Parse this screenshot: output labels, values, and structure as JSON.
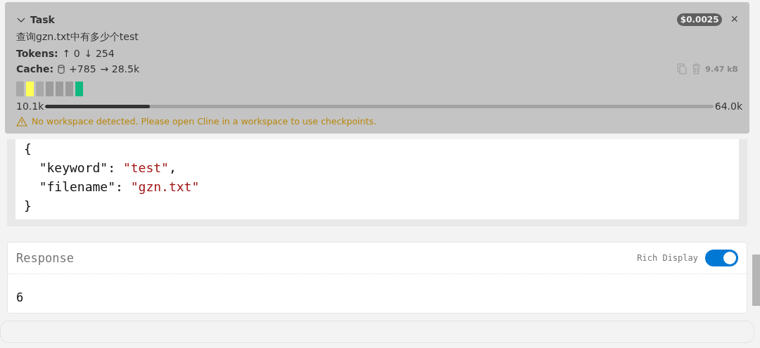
{
  "task": {
    "title": "Task",
    "expanded": true,
    "cost": "$0.0025",
    "close": "×",
    "prompt": "查询gzn.txt中有多少个test",
    "tokens": {
      "label": "Tokens:",
      "up": "↑ 0",
      "down": "↓ 254"
    },
    "cache": {
      "label": "Cache:",
      "added": "+785",
      "arrow": "→ 28.5k"
    },
    "size": "9.47 kB",
    "segments": [
      {
        "color": "#a8a8a8"
      },
      {
        "color": "#ffff55"
      },
      {
        "color": "#a8a8a8"
      },
      {
        "color": "#9c9c9c"
      },
      {
        "color": "#9c9c9c"
      },
      {
        "color": "#9c9c9c"
      },
      {
        "color": "#10b981"
      }
    ],
    "context": {
      "used": "10.1k",
      "level": 0.157,
      "max": "64.0k"
    },
    "warning": "No workspace detected. Please open Cline in a workspace to use checkpoints."
  },
  "arguments": [
    [
      {
        "text": "{",
        "kind": "punct"
      }
    ],
    [
      {
        "text": "  \"keyword\"",
        "kind": "key"
      },
      {
        "text": ": ",
        "kind": "punct"
      },
      {
        "text": "\"test\"",
        "kind": "string"
      },
      {
        "text": ",",
        "kind": "punct"
      }
    ],
    [
      {
        "text": "  \"filename\"",
        "kind": "key"
      },
      {
        "text": ": ",
        "kind": "punct"
      },
      {
        "text": "\"gzn.txt\"",
        "kind": "string"
      }
    ],
    [
      {
        "text": "}",
        "kind": "punct"
      }
    ]
  ],
  "response": {
    "title": "Response",
    "toggle_label": "Rich Display",
    "rich": true,
    "value": "6"
  }
}
